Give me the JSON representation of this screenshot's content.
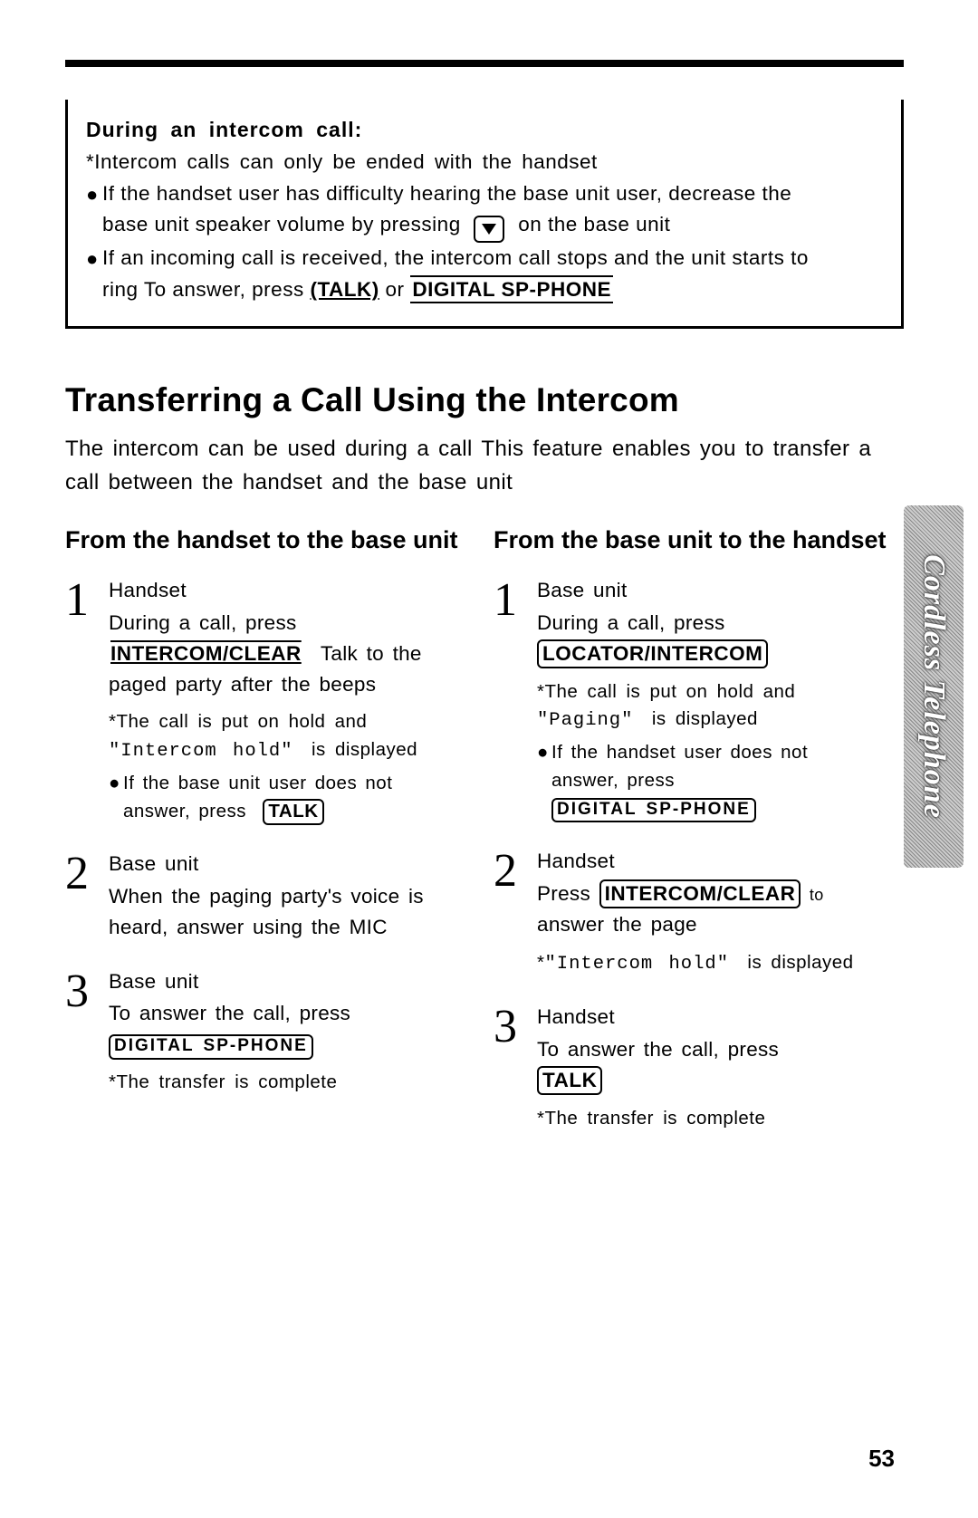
{
  "noteBox": {
    "title": "During an intercom call:",
    "line1_pre": "*Intercom calls can only be ended with the handset",
    "bullet1_a": "If the handset user has difficulty hearing the base unit user, decrease the",
    "bullet1_b": "base unit speaker volume by pressing",
    "bullet1_c": "on the base unit",
    "bullet2_a": "If an incoming call is received, the intercom call stops and the unit starts to",
    "bullet2_b_pre": "ring To answer, press",
    "bullet2_key1": "(TALK)",
    "bullet2_mid": "or",
    "bullet2_key2": "DIGITAL SP-PHONE"
  },
  "sectionTitle": "Transferring a Call Using the Intercom",
  "lead": "The intercom can be used during a call This feature enables you to transfer a call between the handset and the base unit",
  "left": {
    "heading": "From the handset to the base unit",
    "steps": [
      {
        "num": "1",
        "role": "Handset",
        "line1": "During a call, press",
        "key1": "INTERCOM/CLEAR",
        "after1": "Talk to",
        "line2": "the paged party after the beeps",
        "star_a": "*The call is put on hold and",
        "star_b_mono": "\"Intercom hold\"",
        "star_b_post": "is displayed",
        "mini_a": "If the base unit user does not",
        "mini_b": "answer, press",
        "mini_key": "TALK"
      },
      {
        "num": "2",
        "role": "Base unit",
        "line1": "When the paging party's voice is heard, answer using the MIC"
      },
      {
        "num": "3",
        "role": "Base unit",
        "line1": "To answer the call, press",
        "key1": "DIGITAL SP-PHONE",
        "star_a": "*The transfer is complete"
      }
    ]
  },
  "right": {
    "heading": "From the base unit to the handset",
    "steps": [
      {
        "num": "1",
        "role": "Base unit",
        "line1": "During a call, press",
        "key1": "LOCATOR/INTERCOM",
        "star_a": "*The call is put on hold and",
        "star_b_mono": "\"Paging\"",
        "star_b_post": "is displayed",
        "mini_a": "If the handset user does not",
        "mini_b": "answer, press",
        "mini_key": "DIGITAL SP-PHONE"
      },
      {
        "num": "2",
        "role": "Handset",
        "line1_pre": "Press",
        "key1": "INTERCOM/CLEAR",
        "line1_post": "to",
        "line2": "answer the page",
        "star_a_pre": "*",
        "star_a_mono": "\"Intercom hold\"",
        "star_a_post": "is displayed"
      },
      {
        "num": "3",
        "role": "Handset",
        "line1": "To answer the call, press",
        "key1": "TALK",
        "star_a": "*The transfer is complete"
      }
    ]
  },
  "sideTab": "Cordless Telephone",
  "pageNum": "53"
}
